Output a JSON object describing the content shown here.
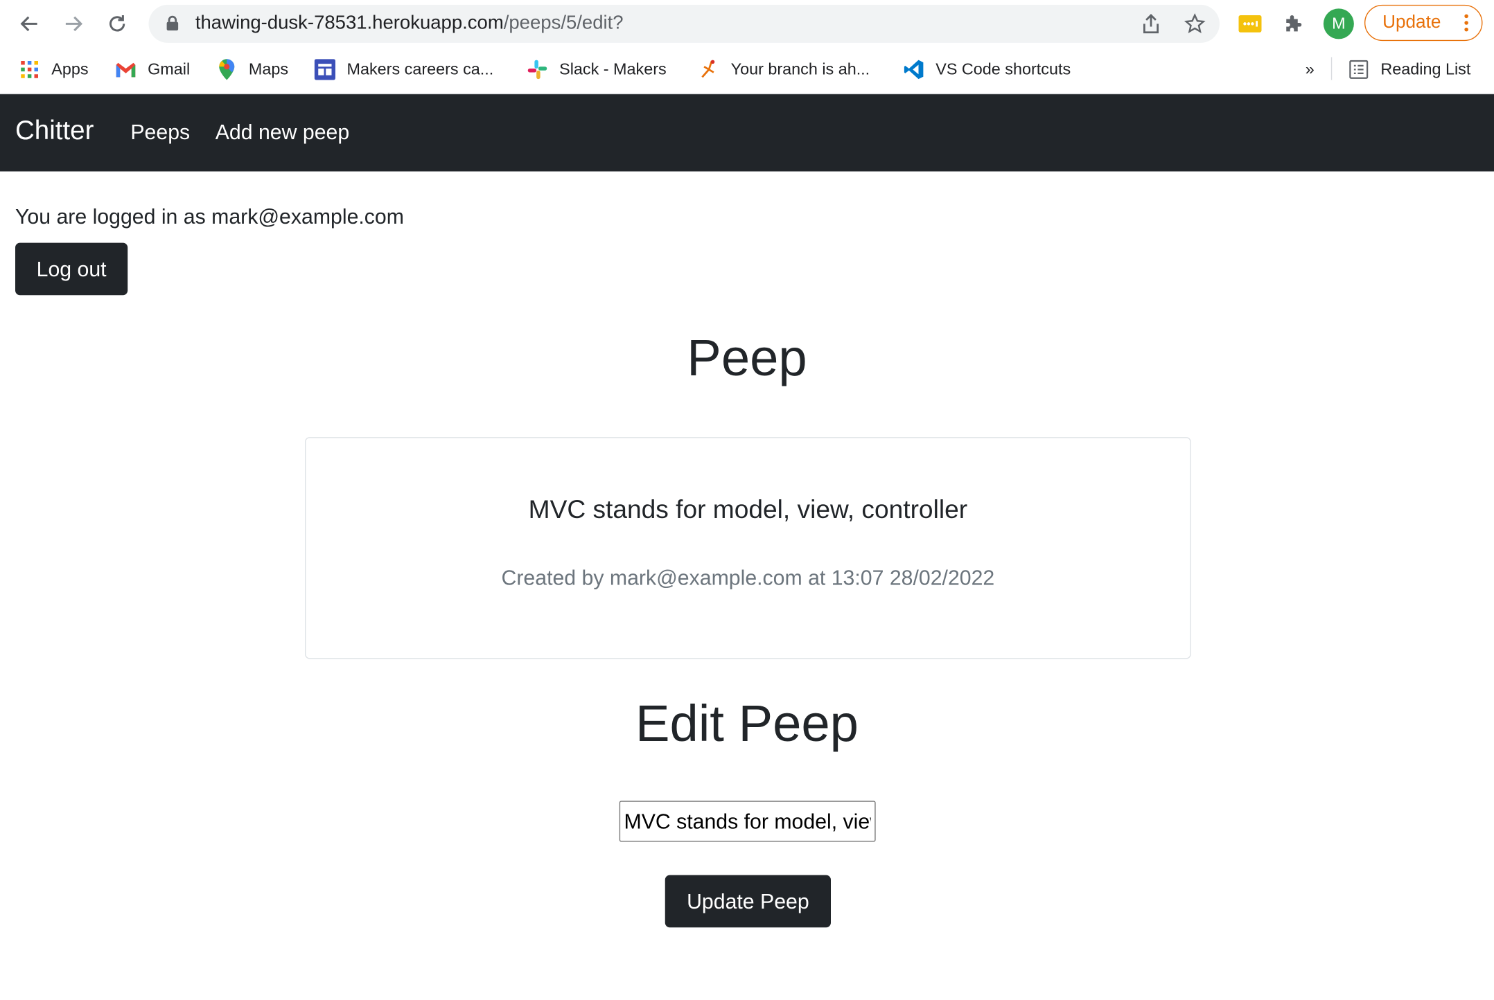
{
  "browser": {
    "url_host": "thawing-dusk-78531.herokuapp.com",
    "url_path": "/peeps/5/edit?",
    "profile_initial": "M",
    "update_label": "Update",
    "bookmarks": [
      {
        "label": "Apps",
        "icon": "apps-grid-icon"
      },
      {
        "label": "Gmail",
        "icon": "gmail-icon"
      },
      {
        "label": "Maps",
        "icon": "maps-pin-icon"
      },
      {
        "label": "Makers careers ca...",
        "icon": "makers-careers-icon"
      },
      {
        "label": "Slack - Makers",
        "icon": "slack-icon"
      },
      {
        "label": "Your branch is ah...",
        "icon": "branch-figure-icon"
      },
      {
        "label": "VS Code shortcuts",
        "icon": "vscode-icon"
      }
    ],
    "overflow_label": "»",
    "reading_list": "Reading List"
  },
  "nav": {
    "brand": "Chitter",
    "links": [
      "Peeps",
      "Add new peep"
    ]
  },
  "session": {
    "logged_in_text": "You are logged in as mark@example.com",
    "logout_label": "Log out"
  },
  "peep": {
    "heading": "Peep",
    "content": "MVC stands for model, view, controller",
    "meta": "Created by mark@example.com at 13:07 28/02/2022"
  },
  "edit": {
    "heading": "Edit Peep",
    "input_value": "MVC stands for model, view, controller",
    "submit_label": "Update Peep"
  },
  "colors": {
    "navbar": "#212529",
    "button": "#212529",
    "update_accent": "#e8710a",
    "muted_text": "#6c757d"
  }
}
